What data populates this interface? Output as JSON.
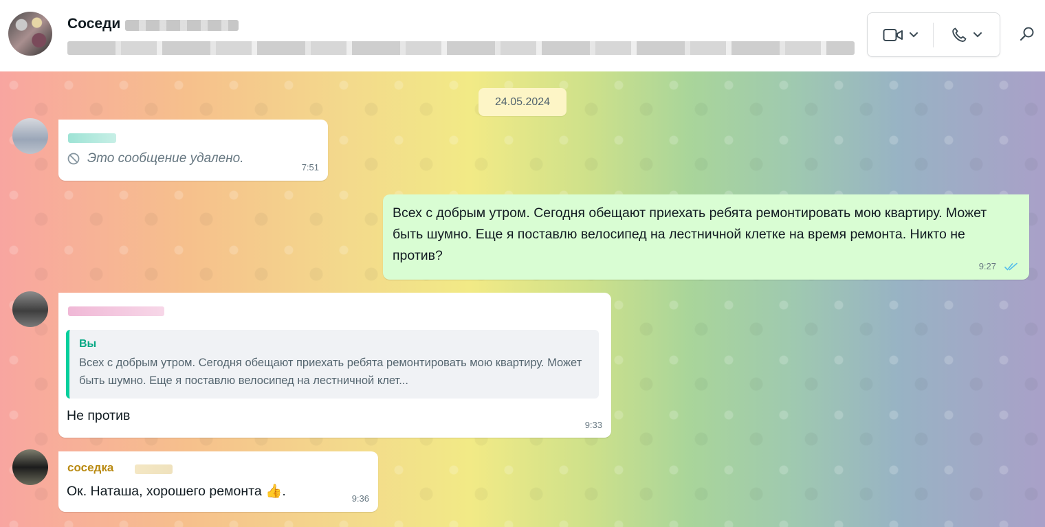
{
  "header": {
    "chat_title": "Соседи",
    "icons": {
      "video": "video-camera-icon",
      "voice": "phone-icon",
      "search": "search-icon"
    }
  },
  "chat": {
    "date_divider": "24.05.2024",
    "messages": [
      {
        "direction": "incoming",
        "deleted_text": "Это сообщение удалено.",
        "time": "7:51"
      },
      {
        "direction": "outgoing",
        "text": "Всех с добрым утром. Сегодня обещают приехать ребята ремонтировать мою квартиру. Может быть шумно. Еще я поставлю велосипед на лестничной клетке на время ремонта. Никто не против?",
        "time": "9:27",
        "status": "read"
      },
      {
        "direction": "incoming",
        "quote_author": "Вы",
        "quote_text": "Всех с добрым утром. Сегодня обещают приехать ребята ремонтировать мою квартиру. Может быть шумно. Еще я поставлю велосипед на лестничной клет...",
        "text": "Не против",
        "time": "9:33"
      },
      {
        "direction": "incoming",
        "sender": "соседка",
        "text": "Ок. Наташа, хорошего ремонта 👍.",
        "time": "9:36"
      }
    ]
  },
  "colors": {
    "outgoing_bubble": "#d9fdd3",
    "incoming_bubble": "#ffffff",
    "quote_accent": "#06cf9c",
    "read_ticks": "#53bdeb",
    "sender_name": "#b98a12"
  }
}
